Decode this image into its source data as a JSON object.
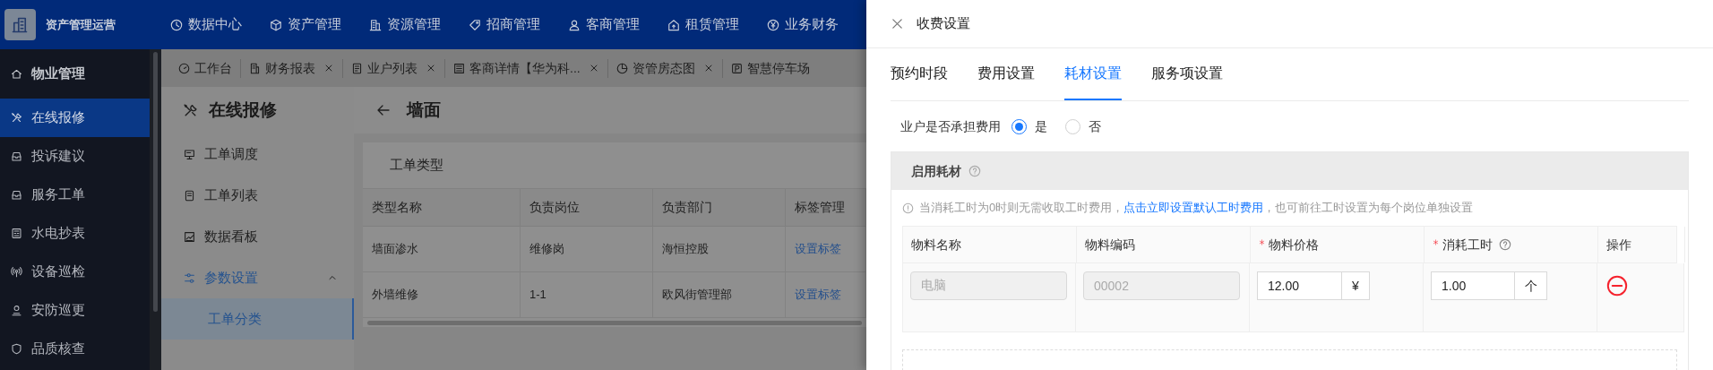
{
  "app": {
    "title": "资产管理运营"
  },
  "top_nav": [
    {
      "label": "数据中心"
    },
    {
      "label": "资产管理"
    },
    {
      "label": "资源管理"
    },
    {
      "label": "招商管理"
    },
    {
      "label": "客商管理"
    },
    {
      "label": "租赁管理"
    },
    {
      "label": "业务财务"
    }
  ],
  "sidebar": {
    "header": "物业管理",
    "items": [
      {
        "label": "在线报修",
        "selected": true
      },
      {
        "label": "投诉建议",
        "selected": false
      },
      {
        "label": "服务工单",
        "selected": false
      },
      {
        "label": "水电抄表",
        "selected": false
      },
      {
        "label": "设备巡检",
        "selected": false
      },
      {
        "label": "安防巡更",
        "selected": false
      },
      {
        "label": "品质核查",
        "selected": false
      }
    ]
  },
  "page_tabs": [
    {
      "label": "工作台",
      "closable": false
    },
    {
      "label": "财务报表",
      "closable": true
    },
    {
      "label": "业户列表",
      "closable": true
    },
    {
      "label": "客商详情【华为科...",
      "closable": true
    },
    {
      "label": "资管房态图",
      "closable": true
    },
    {
      "label": "智慧停车场",
      "closable": false
    }
  ],
  "module": {
    "title": "在线报修",
    "menu": [
      {
        "label": "工单调度",
        "expanded": false,
        "selected": false
      },
      {
        "label": "工单列表",
        "expanded": false,
        "selected": false
      },
      {
        "label": "数据看板",
        "expanded": false,
        "selected": false
      },
      {
        "label": "参数设置",
        "expanded": true,
        "selected": false,
        "children": [
          {
            "label": "工单分类",
            "selected": true
          }
        ]
      }
    ]
  },
  "page": {
    "title": "墙面",
    "card_title": "工单类型",
    "table": {
      "columns": [
        "类型名称",
        "负责岗位",
        "负责部门",
        "标签管理"
      ],
      "rows": [
        [
          "墙面渗水",
          "维修岗",
          "海恒控股",
          "设置标签"
        ],
        [
          "外墙维修",
          "1-1",
          "欧风街管理部",
          "设置标签"
        ]
      ]
    }
  },
  "drawer": {
    "title": "收费设置",
    "tabs": [
      {
        "label": "预约时段",
        "selected": false
      },
      {
        "label": "费用设置",
        "selected": false
      },
      {
        "label": "耗材设置",
        "selected": true
      },
      {
        "label": "服务项设置",
        "selected": false
      }
    ],
    "bear_cost": {
      "label": "业户是否承担费用",
      "options": [
        {
          "label": "是",
          "selected": true
        },
        {
          "label": "否",
          "selected": false
        }
      ]
    },
    "section": {
      "title": "启用耗材",
      "notice_before": "当消耗工时为0时则无需收取工时费用，",
      "notice_link": "点击立即设置默认工时费用",
      "notice_after": "，也可前往工时设置为每个岗位单独设置",
      "columns": [
        {
          "label": "物料名称",
          "required": false,
          "help": false
        },
        {
          "label": "物料编码",
          "required": false,
          "help": false
        },
        {
          "label": "物料价格",
          "required": true,
          "help": false
        },
        {
          "label": "消耗工时",
          "required": true,
          "help": true
        },
        {
          "label": "操作",
          "required": false,
          "help": false
        }
      ],
      "rows": [
        {
          "name": "电脑",
          "code": "00002",
          "price": "12.00",
          "price_unit": "¥",
          "hours": "1.00",
          "hours_unit": "个"
        }
      ]
    }
  }
}
